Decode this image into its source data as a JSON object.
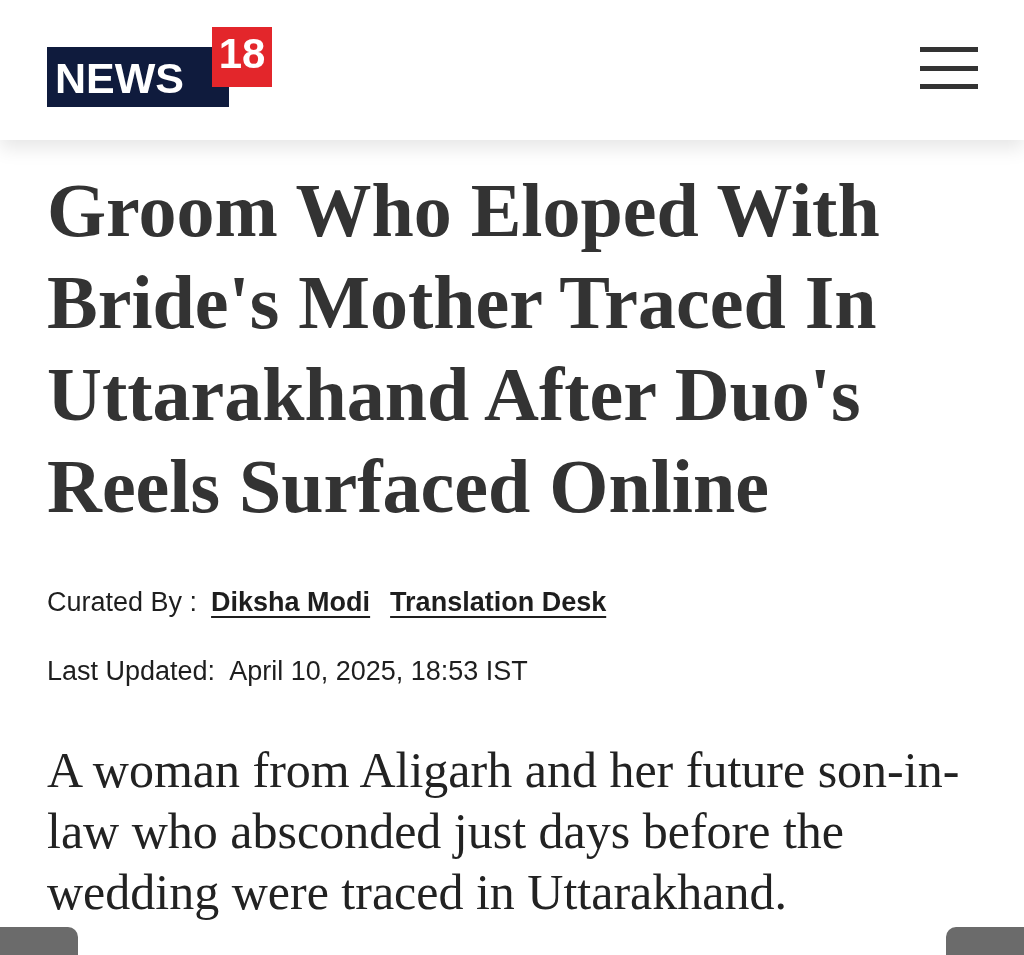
{
  "header": {
    "logo": {
      "word": "NEWS",
      "number": "18"
    }
  },
  "article": {
    "headline": "Groom Who Eloped With Bride's Mother Traced In Uttarakhand After Duo's Reels Surfaced Online",
    "byline": {
      "label": "Curated By :",
      "authors": [
        "Diksha Modi",
        "Translation Desk"
      ]
    },
    "updated": {
      "label": "Last Updated:",
      "value": "April 10, 2025, 18:53 IST"
    },
    "summary": "A woman from Aligarh and her future son-in-law who absconded just days before the wedding were traced in Uttarakhand."
  }
}
